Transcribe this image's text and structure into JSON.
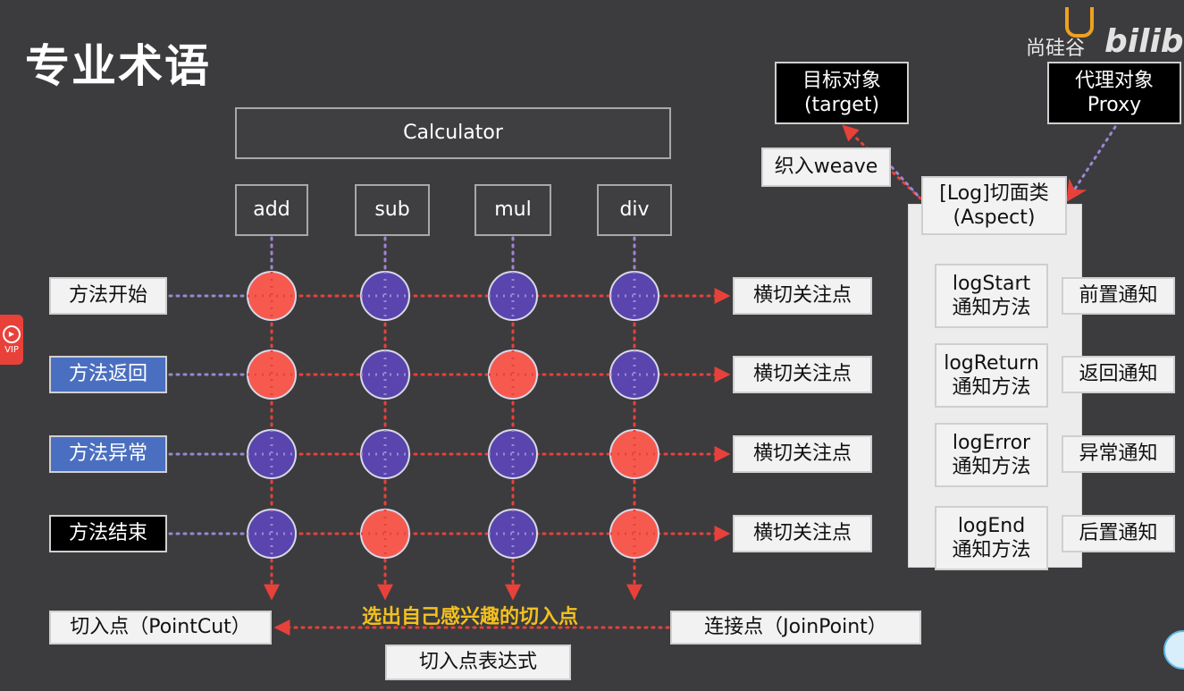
{
  "title": "专业术语",
  "watermark": {
    "brand": "尚硅谷",
    "site": "bilibili"
  },
  "vip_label": "VIP",
  "calculator": "Calculator",
  "methods": [
    "add",
    "sub",
    "mul",
    "div"
  ],
  "row_labels": [
    {
      "label": "方法开始",
      "style": "white"
    },
    {
      "label": "方法返回",
      "style": "blue"
    },
    {
      "label": "方法异常",
      "style": "blue"
    },
    {
      "label": "方法结束",
      "style": "black"
    }
  ],
  "cross_cut_label": "横切关注点",
  "grid_highlights": [
    [
      true,
      false,
      false,
      false
    ],
    [
      true,
      false,
      true,
      false
    ],
    [
      false,
      false,
      false,
      true
    ],
    [
      false,
      true,
      false,
      true
    ]
  ],
  "colors": {
    "background": "#3c3c3e",
    "point_red": "#f65a4f",
    "point_blue": "#5945ad",
    "arrow_red": "#e8413a",
    "dotted_purple": "#9b86d4",
    "highlight_yellow": "#f4c01e"
  },
  "target": {
    "line1": "目标对象",
    "line2": "(target)"
  },
  "proxy": {
    "line1": "代理对象",
    "line2": "Proxy"
  },
  "weave": "织入weave",
  "aspect": {
    "line1": "[Log]切面类",
    "line2": "(Aspect)"
  },
  "advice_methods": [
    {
      "name": "logStart",
      "sub": "通知方法",
      "advice": "前置通知"
    },
    {
      "name": "logReturn",
      "sub": "通知方法",
      "advice": "返回通知"
    },
    {
      "name": "logError",
      "sub": "通知方法",
      "advice": "异常通知"
    },
    {
      "name": "logEnd",
      "sub": "通知方法",
      "advice": "后置通知"
    }
  ],
  "pointcut": "切入点（PointCut）",
  "joinpoint": "连接点（JoinPoint）",
  "select_text": "选出自己感兴趣的切入点",
  "pointcut_expr": "切入点表达式"
}
